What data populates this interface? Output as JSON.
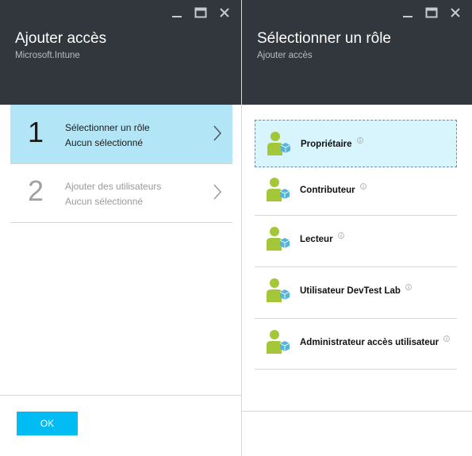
{
  "left_blade": {
    "title": "Ajouter accès",
    "subtitle": "Microsoft.Intune",
    "steps": [
      {
        "number": "1",
        "title": "Sélectionner un rôle",
        "status": "Aucun sélectionné",
        "active": true
      },
      {
        "number": "2",
        "title": "Ajouter des utilisateurs",
        "status": "Aucun sélectionné",
        "active": false
      }
    ],
    "ok_label": "OK"
  },
  "right_blade": {
    "title": "Sélectionner un rôle",
    "subtitle": "Ajouter accès",
    "roles": [
      {
        "label": "Propriétaire",
        "selected": true
      },
      {
        "label": "Contributeur",
        "selected": false
      },
      {
        "label": "Lecteur",
        "selected": false
      },
      {
        "label": "Utilisateur DevTest Lab",
        "selected": false
      },
      {
        "label": "Administrateur accès utilisateur",
        "selected": false
      }
    ]
  },
  "colors": {
    "header_bg": "#32363d",
    "active_step_bg": "#b2e6f7",
    "selected_role_bg": "#d8f4fc",
    "ok_button_bg": "#00bcf2",
    "role_icon_green": "#a4c639",
    "role_icon_blue": "#59b4d9"
  },
  "icons": {
    "window_controls": [
      "minimize-icon",
      "maximize-icon",
      "close-icon"
    ],
    "step_arrow": "chevron-right-icon",
    "role": "user-role-icon",
    "info": "info-icon"
  }
}
